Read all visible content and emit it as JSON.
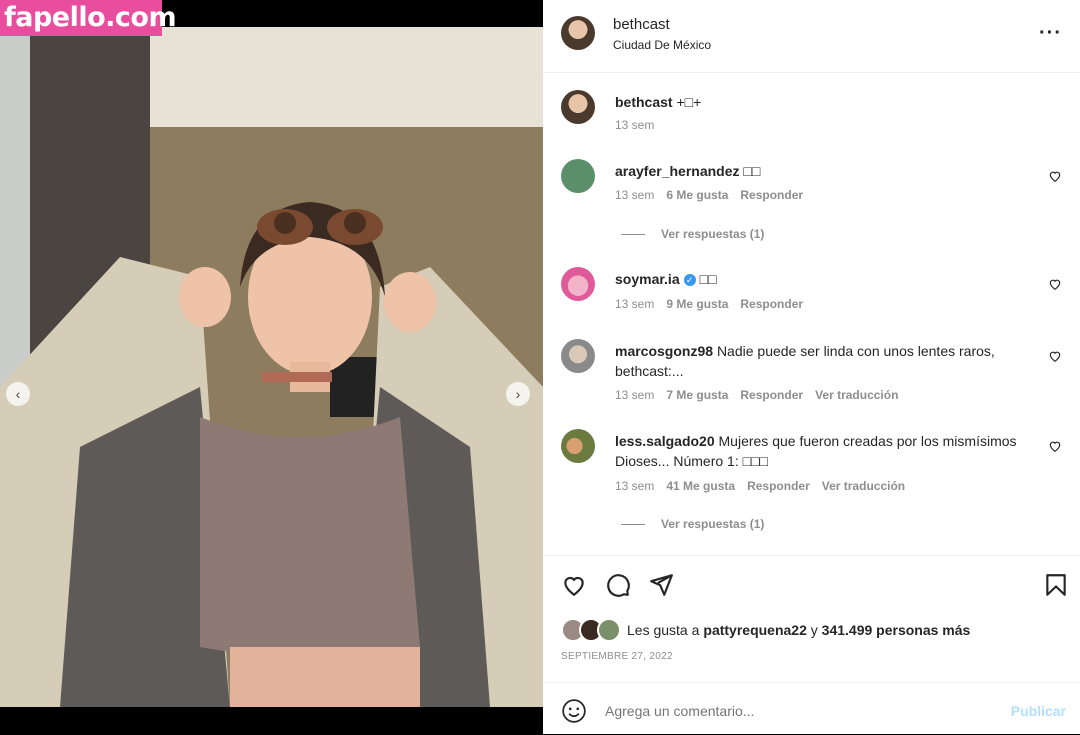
{
  "watermark": "fapello.com",
  "post": {
    "username": "bethcast",
    "location": "Ciudad De México",
    "caption": "+□+",
    "caption_time": "13 sem"
  },
  "comments": [
    {
      "user": "arayfer_hernandez",
      "text": "□□",
      "time": "13 sem",
      "likes": "6 Me gusta",
      "reply": "Responder",
      "translate": "",
      "replies": "Ver respuestas (1)",
      "avatar_color": "#5a8f6a"
    },
    {
      "user": "soymar.ia",
      "verified": true,
      "text": "□□",
      "time": "13 sem",
      "likes": "9 Me gusta",
      "reply": "Responder",
      "translate": "",
      "replies": "",
      "avatar_color": "#e05a9a"
    },
    {
      "user": "marcosgonz98",
      "text": "Nadie puede ser linda con unos lentes raros, bethcast:...",
      "time": "13 sem",
      "likes": "7 Me gusta",
      "reply": "Responder",
      "translate": "Ver traducción",
      "replies": "",
      "avatar_color": "#9a9a9a"
    },
    {
      "user": "less.salgado20",
      "text": "Mujeres que fueron creadas por los mismísimos Dioses... Número 1: □□□",
      "time": "13 sem",
      "likes": "41 Me gusta",
      "reply": "Responder",
      "translate": "Ver traducción",
      "replies": "Ver respuestas (1)",
      "avatar_color": "#6b7a3f"
    }
  ],
  "likes": {
    "prefix": "Les gusta a ",
    "user": "pattyrequena22",
    "middle": " y ",
    "count": "341.499 personas más"
  },
  "date": "SEPTIEMBRE 27, 2022",
  "add_comment": {
    "placeholder": "Agrega un comentario...",
    "publish": "Publicar"
  },
  "icons": {
    "like": "heart-icon",
    "comment": "comment-icon",
    "share": "send-icon",
    "save": "bookmark-icon",
    "emoji": "emoji-icon",
    "more": "more-icon"
  },
  "colors": {
    "watermark_bg": "#e94e9e",
    "publish": "#b2dffc",
    "verified": "#3897f0"
  },
  "carousel": {
    "slides": 5,
    "active": 1
  }
}
